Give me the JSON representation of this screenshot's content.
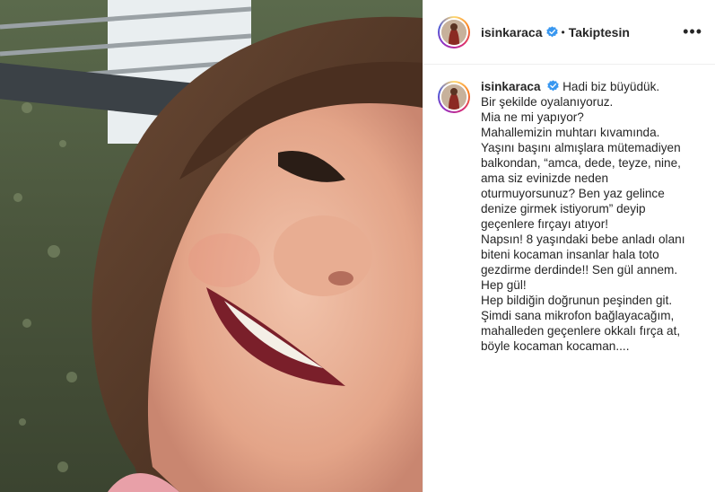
{
  "header": {
    "username": "isinkaraca",
    "separator": "•",
    "follow_status": "Takiptesin",
    "more_icon": "more-horizontal-icon"
  },
  "caption": {
    "username": "isinkaraca",
    "lines": [
      "Hadi biz büyüdük.",
      "Bir şekilde oyalanıyoruz.",
      "Mia ne mi yapıyor?",
      "Mahallemizin muhtarı kıvamında.",
      "Yaşını başını almışlara mütemadiyen",
      "balkondan, “amca, dede, teyze, nine,",
      "ama siz evinizde neden",
      "oturmuyorsunuz? Ben yaz gelince",
      "denize girmek istiyorum” deyip",
      "geçenlere fırçayı atıyor!",
      "Napsın! 8 yaşındaki bebe anladı olanı",
      "biteni kocaman insanlar hala toto",
      "gezdirme derdinde!! Sen gül annem.",
      "Hep gül!",
      "Hep bildiğin doğrunun peşinden git.",
      "Şimdi sana mikrofon bağlayacağım,",
      "mahalleden geçenlere okkalı fırça at,",
      "böyle kocaman kocaman...."
    ]
  },
  "colors": {
    "verified": "#3897f0",
    "text": "#262626",
    "border": "#efefef"
  }
}
